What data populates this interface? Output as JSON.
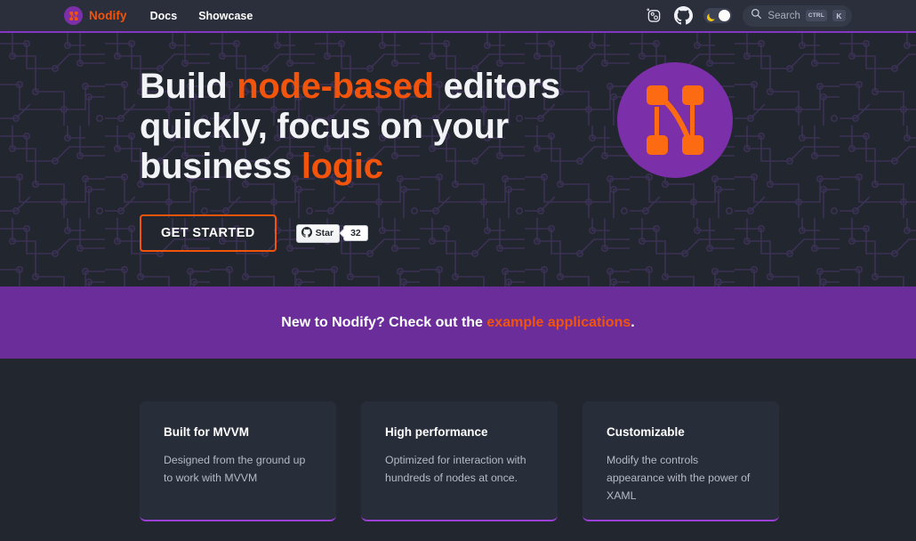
{
  "header": {
    "brand": {
      "name": "Nodify",
      "logo_icon": "nodify-node-logo-icon"
    },
    "nav": [
      {
        "label": "Docs"
      },
      {
        "label": "Showcase"
      }
    ],
    "actions": {
      "discord_icon": "discord-icon",
      "github_icon": "github-icon",
      "theme_toggle": {
        "moon_icon": "moon-icon",
        "state": "dark"
      },
      "search": {
        "icon": "search-icon",
        "placeholder": "Search",
        "kbd_modifier": "CTRL",
        "kbd_key": "K"
      }
    }
  },
  "hero": {
    "title_line1_a": "Build ",
    "title_line1_accent": "node-based",
    "title_line1_b": " editors",
    "title_line2": "quickly, focus on your",
    "title_line3_a": "business ",
    "title_line3_accent": "logic",
    "cta_label": "GET STARTED",
    "github_star": {
      "icon": "github-icon",
      "label": "Star",
      "count": "32"
    },
    "logo_icon": "nodify-node-logo-icon"
  },
  "banner": {
    "text_before": "New to Nodify? Check out the ",
    "link": "example applications",
    "text_after": "."
  },
  "features": {
    "cards": [
      {
        "title": "Built for MVVM",
        "description": "Designed from the ground up to work with MVVM"
      },
      {
        "title": "High performance",
        "description": "Optimized for interaction with hundreds of nodes at once."
      },
      {
        "title": "Customizable",
        "description": "Modify the controls appearance with the power of XAML"
      }
    ]
  },
  "colors": {
    "page_bg": "#22262f",
    "header_bg": "#2b2f3b",
    "header_border": "#8335c4",
    "accent_orange": "#f1540a",
    "banner_purple": "#6b2d99",
    "card_bg": "#282d3a",
    "card_accent": "#9b3fd6",
    "logo_circle": "#7b2fa8",
    "circuit_trace": "#3a2f55"
  }
}
